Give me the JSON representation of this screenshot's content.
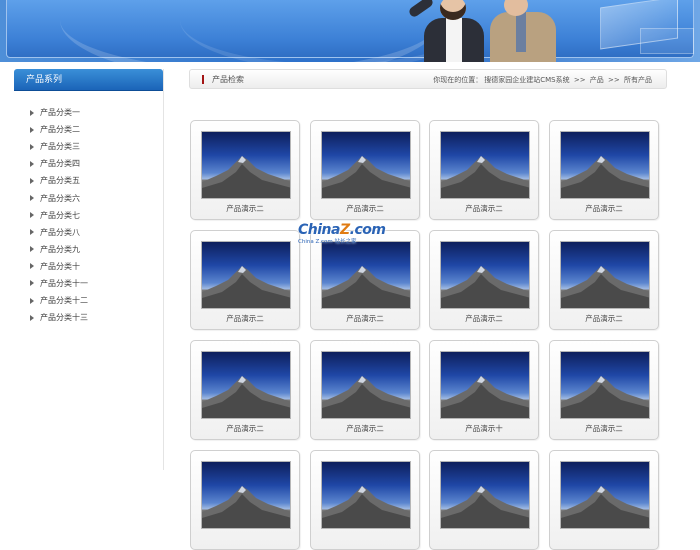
{
  "banner": {},
  "sidebar": {
    "title": "产品系列",
    "items": [
      {
        "label": "产品分类一"
      },
      {
        "label": "产品分类二"
      },
      {
        "label": "产品分类三"
      },
      {
        "label": "产品分类四"
      },
      {
        "label": "产品分类五"
      },
      {
        "label": "产品分类六"
      },
      {
        "label": "产品分类七"
      },
      {
        "label": "产品分类八"
      },
      {
        "label": "产品分类九"
      },
      {
        "label": "产品分类十"
      },
      {
        "label": "产品分类十一"
      },
      {
        "label": "产品分类十二"
      },
      {
        "label": "产品分类十三"
      }
    ]
  },
  "main": {
    "title": "产品检索",
    "breadcrumb": {
      "prefix": "你现在的位置：",
      "crumbs": [
        "搜德家园企业建站CMS系统",
        ">>",
        "产品",
        ">>",
        "所有产品"
      ]
    },
    "products": [
      {
        "caption": "产品演示二"
      },
      {
        "caption": "产品演示二"
      },
      {
        "caption": "产品演示二"
      },
      {
        "caption": "产品演示二"
      },
      {
        "caption": "产品演示二"
      },
      {
        "caption": "产品演示二"
      },
      {
        "caption": "产品演示二"
      },
      {
        "caption": "产品演示二"
      },
      {
        "caption": "产品演示二"
      },
      {
        "caption": "产品演示二"
      },
      {
        "caption": "产品演示十"
      },
      {
        "caption": "产品演示二"
      },
      {
        "caption": ""
      },
      {
        "caption": ""
      },
      {
        "caption": ""
      },
      {
        "caption": ""
      }
    ]
  },
  "watermark": {
    "logo_left": "China",
    "logo_mid": "Z",
    "logo_right": ".com",
    "subtitle": "China Z.com 站长之家"
  },
  "colors": {
    "sidebar_header": "#1b64b8",
    "accent_marker": "#a31414",
    "banner": "#2f73cc"
  }
}
